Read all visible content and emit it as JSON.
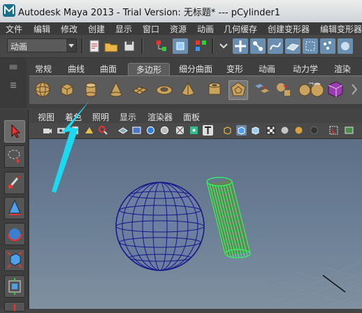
{
  "window": {
    "title": "Autodesk Maya 2013 - Trial Version: 无标题*    ---    pCylinder1"
  },
  "menubar": {
    "items": [
      "文件",
      "编辑",
      "修改",
      "创建",
      "显示",
      "窗口",
      "资源",
      "动画",
      "几何缓存",
      "创建变形器",
      "编辑变形器"
    ]
  },
  "statusline": {
    "mode_label": "动画"
  },
  "shelf": {
    "tabs": [
      "常规",
      "曲线",
      "曲面",
      "多边形",
      "细分曲面",
      "变形",
      "动画",
      "动力学",
      "渲染"
    ],
    "active_tab": "多边形",
    "icons": [
      "poly-sphere-icon",
      "poly-cube-icon",
      "poly-cylinder-icon",
      "poly-cone-icon",
      "poly-plane-icon",
      "poly-torus-icon",
      "poly-pyramid-icon",
      "poly-pipe-icon",
      "poly-soccer-ball-icon",
      "combine-icon",
      "separate-icon",
      "extract-icon",
      "smooth-icon",
      "booleans-icon",
      "cube-uv-icon"
    ]
  },
  "panel": {
    "menu": [
      "视图",
      "着色",
      "照明",
      "显示",
      "渲染器",
      "面板"
    ]
  },
  "viewport": {
    "objects": [
      {
        "name": "pSphere1",
        "type": "sphere",
        "wire_color": "#1e1e8c"
      },
      {
        "name": "pCylinder1",
        "type": "cylinder",
        "wire_color": "#33ff66",
        "selected": true
      }
    ],
    "annotation_arrow_color": "#1ed8f0"
  },
  "colors": {
    "viewport_top": "#5d6f86",
    "viewport_bottom": "#7f909f",
    "ui_dark": "#3b3b3b",
    "selection_green": "#33ff66"
  }
}
